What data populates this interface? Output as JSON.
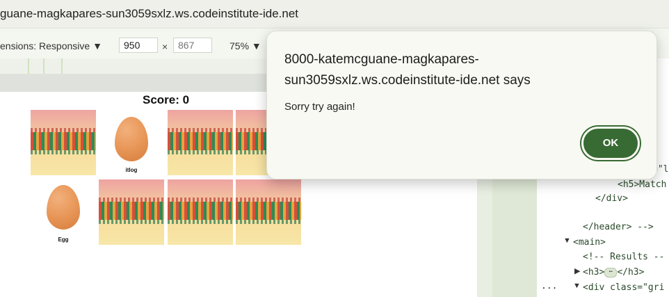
{
  "browser": {
    "url": "guane-magkapares-sun3059sxlz.ws.codeinstitute-ide.net"
  },
  "device_toolbar": {
    "dimensions_label": "ensions: Responsive ▼",
    "width_value": "950",
    "times": "×",
    "height_placeholder": "867",
    "zoom": "75% ▼"
  },
  "game": {
    "score": "Score: 0",
    "face_labels": [
      "itlog",
      "Egg"
    ]
  },
  "devtools": {
    "lines": [
      "=\"l",
      "<h5>Match",
      "</div>",
      "</header> -->",
      "<main>",
      "<!-- Results --",
      "<h3>",
      "</h3>",
      "<div class=\"gri"
    ],
    "ellipsis": "..."
  },
  "dialog": {
    "title": "8000-katemcguane-magkapares-sun3059sxlz.ws.codeinstitute-ide.net says",
    "message": "Sorry try again!",
    "ok_label": "OK"
  },
  "colors": {
    "ok_button": "#386a33",
    "dialog_bg": "#f8f9f2"
  }
}
